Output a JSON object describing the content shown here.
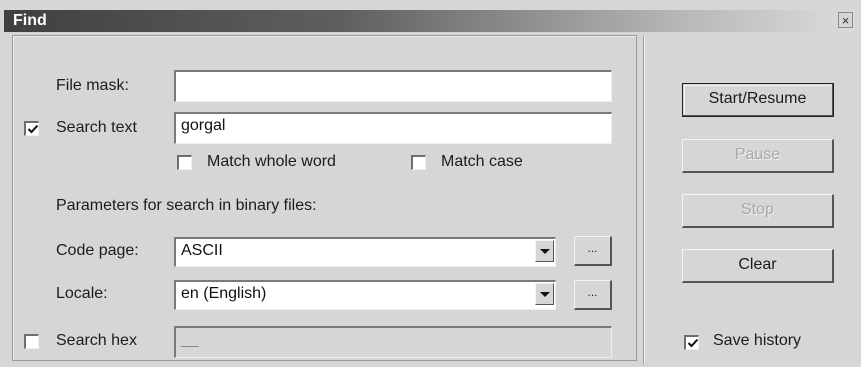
{
  "window": {
    "title": "Find",
    "close_glyph": "×"
  },
  "form": {
    "file_mask": {
      "label": "File mask:",
      "value": ""
    },
    "search_text": {
      "label": "Search text",
      "checked": true,
      "value": "gorgal"
    },
    "match_whole_word": {
      "label": "Match whole word",
      "checked": false
    },
    "match_case": {
      "label": "Match case",
      "checked": false
    },
    "binary_params_heading": "Parameters for search in binary files:",
    "code_page": {
      "label": "Code page:",
      "value": "ASCII",
      "browse_label": "..."
    },
    "locale": {
      "label": "Locale:",
      "value": "en (English)",
      "browse_label": "..."
    },
    "search_hex": {
      "label": "Search hex",
      "checked": false,
      "value": "__"
    }
  },
  "actions": {
    "start_resume": "Start/Resume",
    "pause": "Pause",
    "stop": "Stop",
    "clear": "Clear",
    "save_history": {
      "label": "Save history",
      "checked": true
    }
  },
  "icons": {
    "checkmark": "check-icon",
    "dropdown": "chevron-down-icon",
    "close": "close-icon"
  }
}
